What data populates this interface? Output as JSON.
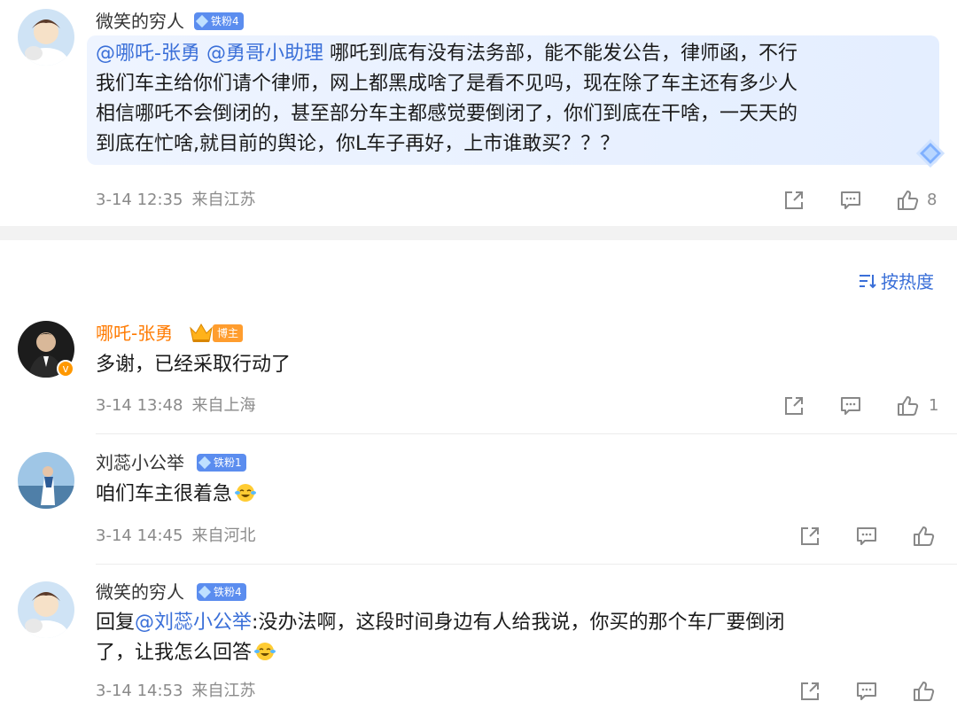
{
  "post": {
    "user": "微笑的穷人",
    "fan_badge": "铁粉4",
    "mentions": [
      "@哪吒-张勇",
      "@勇哥小助理"
    ],
    "text": "哪吒到底有没有法务部，能不能发公告，律师函，不行我们车主给你们请个律师，网上都黑成啥了是看不见吗，现在除了车主还有多少人相信哪吒不会倒闭的，甚至部分车主都感觉要倒闭了，你们到底在干啥，一天天的到底在忙啥,就目前的舆论，你L车子再好，上市谁敢买？？？",
    "line1_rest": " 哪吒到底有没有法务部，能不能发公告，律师函，不行",
    "line2": "我们车主给你们请个律师，网上都黑成啥了是看不见吗，现在除了车主还有多少人",
    "line3": "相信哪吒不会倒闭的，甚至部分车主都感觉要倒闭了，你们到底在干啥，一天天的",
    "line4": "到底在忙啥,就目前的舆论，你L车子再好，上市谁敢买？？？",
    "date": "3-14 12:35",
    "location": "来自江苏",
    "likes": "8"
  },
  "sort_label": "按热度",
  "replies": [
    {
      "user": "哪吒-张勇",
      "badge": "博主",
      "text": "多谢，已经采取行动了",
      "date": "3-14 13:48",
      "location": "来自上海",
      "likes": "1"
    },
    {
      "user": "刘蕊小公举",
      "fan_badge": "铁粉1",
      "text": "咱们车主很着急",
      "date": "3-14 14:45",
      "location": "来自河北"
    },
    {
      "user": "微笑的穷人",
      "fan_badge": "铁粉4",
      "reply_prefix": "回复",
      "reply_to": "@刘蕊小公举",
      "text_line1": ":没办法啊，这段时间身边有人给我说，你买的那个车厂要倒闭",
      "text_line2": "了，让我怎么回答",
      "date": "3-14 14:53",
      "location": "来自江苏"
    }
  ],
  "icons": {
    "share": "share-icon",
    "comment": "comment-icon",
    "like": "thumbs-up-icon",
    "sort": "sort-icon",
    "laugh": "laugh-cry-emoji-icon"
  },
  "colors": {
    "mention": "#3a6fd8",
    "vip_name": "#ff7a00",
    "fan_badge": "#5b8def",
    "meta": "#8a8a8a",
    "sort_link": "#3a6fd8"
  }
}
